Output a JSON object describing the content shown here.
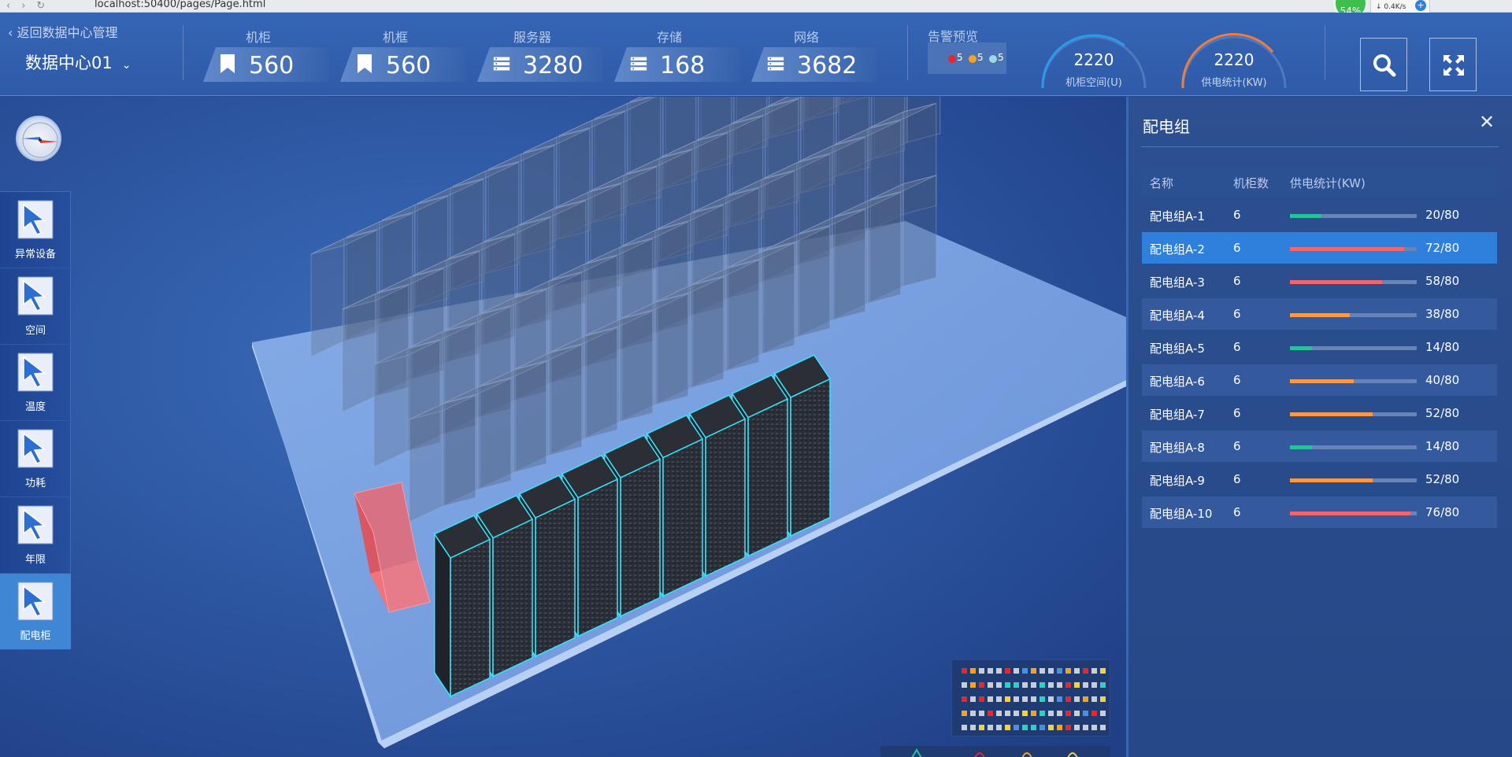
{
  "browser": {
    "url": "localhost:50400/pages/Page.html",
    "battery": "54%",
    "net_down": "0.4K/s"
  },
  "header": {
    "back_link": "返回数据中心管理",
    "datacenter": "数据中心01",
    "stats": [
      {
        "label": "机柜",
        "value": "560",
        "icon": "bookmark-icon"
      },
      {
        "label": "机框",
        "value": "560",
        "icon": "bookmark-icon"
      },
      {
        "label": "服务器",
        "value": "3280",
        "icon": "server-icon"
      },
      {
        "label": "存储",
        "value": "168",
        "icon": "server-icon"
      },
      {
        "label": "网络",
        "value": "3682",
        "icon": "server-icon"
      }
    ],
    "alarm": {
      "label": "告警预览",
      "items": [
        {
          "count": "5",
          "color": "#e8262b"
        },
        {
          "count": "5",
          "color": "#f6a21a"
        },
        {
          "count": "5",
          "color": "#9fd6e8"
        }
      ]
    },
    "gauges": [
      {
        "value": "2220",
        "label": "机柜空间(U)",
        "color": "#2a9be8"
      },
      {
        "value": "2220",
        "label": "供电统计(KW)",
        "color": "#f07d3a"
      }
    ]
  },
  "toolbar": [
    {
      "label": "异常设备"
    },
    {
      "label": "空间"
    },
    {
      "label": "温度"
    },
    {
      "label": "功耗"
    },
    {
      "label": "年限"
    },
    {
      "label": "配电柜",
      "active": true
    }
  ],
  "panel": {
    "title": "配电组",
    "columns": [
      "名称",
      "机柜数",
      "供电统计(KW)"
    ],
    "rows": [
      {
        "name": "配电组A-1",
        "count": "6",
        "usage": "20/80",
        "fraction": 0.25,
        "color": "#25c29b"
      },
      {
        "name": "配电组A-2",
        "count": "6",
        "usage": "72/80",
        "fraction": 0.9,
        "color": "#f0666c",
        "selected": true
      },
      {
        "name": "配电组A-3",
        "count": "6",
        "usage": "58/80",
        "fraction": 0.725,
        "color": "#f0666c"
      },
      {
        "name": "配电组A-4",
        "count": "6",
        "usage": "38/80",
        "fraction": 0.475,
        "color": "#f89a4a"
      },
      {
        "name": "配电组A-5",
        "count": "6",
        "usage": "14/80",
        "fraction": 0.175,
        "color": "#25c29b"
      },
      {
        "name": "配电组A-6",
        "count": "6",
        "usage": "40/80",
        "fraction": 0.5,
        "color": "#f89a4a"
      },
      {
        "name": "配电组A-7",
        "count": "6",
        "usage": "52/80",
        "fraction": 0.65,
        "color": "#f89a4a"
      },
      {
        "name": "配电组A-8",
        "count": "6",
        "usage": "14/80",
        "fraction": 0.175,
        "color": "#25c29b"
      },
      {
        "name": "配电组A-9",
        "count": "6",
        "usage": "52/80",
        "fraction": 0.65,
        "color": "#f89a4a"
      },
      {
        "name": "配电组A-10",
        "count": "6",
        "usage": "76/80",
        "fraction": 0.95,
        "color": "#f0666c"
      }
    ]
  },
  "colors": {
    "accent": "#2f7fdc",
    "alert_cabinet": "#ff6b6b",
    "cabinet_outline": "#32e6ff"
  }
}
